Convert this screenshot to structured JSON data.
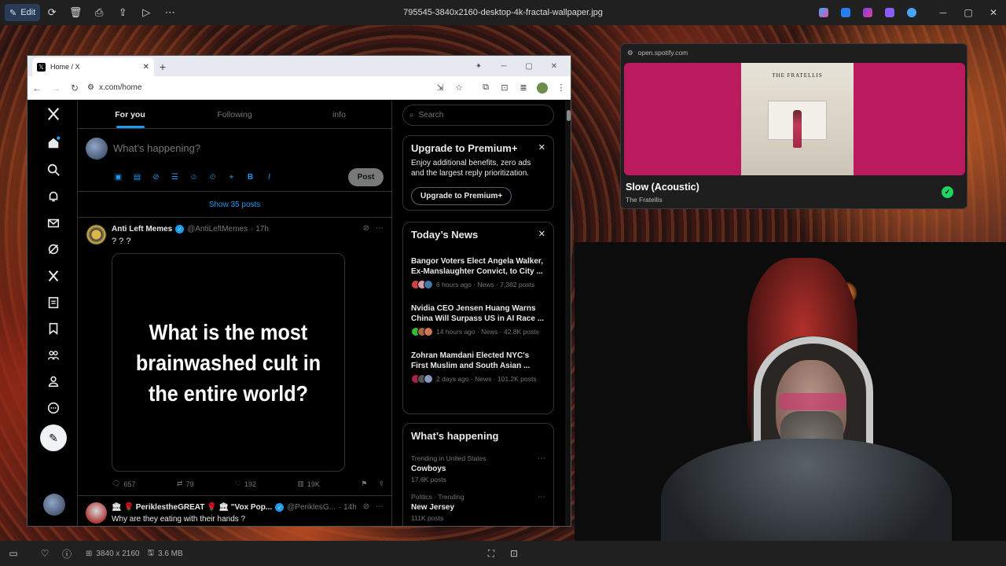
{
  "viewer": {
    "edit_label": "Edit",
    "file_title": "795545-3840x2160-desktop-4k-fractal-wallpaper.jpg",
    "dimensions": "3840 x 2160",
    "file_size": "3.6 MB"
  },
  "browser": {
    "tab_title": "Home / X",
    "url": "x.com/home"
  },
  "x": {
    "tabs": [
      "For you",
      "Following",
      "info"
    ],
    "compose_placeholder": "What’s happening?",
    "post_button": "Post",
    "show_posts": "Show 35 posts",
    "tweet1": {
      "name": "Anti Left Memes",
      "handle": "@AntiLeftMemes",
      "time": "· 17h",
      "text": "? ? ?",
      "image_text": "What is the most brainwashed cult in the entire world?",
      "replies": "657",
      "reposts": "79",
      "likes": "192",
      "views": "19K"
    },
    "tweet2": {
      "name": "🏛 🌹 PeriklestheGREAT 🌹 🏛 \"Vox Pop...",
      "handle": "@PeriklesG...",
      "time": "· 14h",
      "text": "Why are they eating with their hands ?"
    },
    "search_placeholder": "Search",
    "premium": {
      "title": "Upgrade to Premium+",
      "body": "Enjoy additional benefits, zero ads and the largest reply prioritization.",
      "button": "Upgrade to Premium+"
    },
    "news": {
      "title": "Today’s News",
      "items": [
        {
          "headline": "Bangor Voters Elect Angela Walker, Ex-Manslaughter Convict, to City ...",
          "meta": "6 hours ago · News · 7,382 posts"
        },
        {
          "headline": "Nvidia CEO Jensen Huang Warns China Will Surpass US in AI Race ...",
          "meta": "14 hours ago · News · 42.8K posts"
        },
        {
          "headline": "Zohran Mamdani Elected NYC's First Muslim and South Asian ...",
          "meta": "2 days ago · News · 101.2K posts"
        }
      ]
    },
    "happening": {
      "title": "What’s happening",
      "items": [
        {
          "category": "Trending in United States",
          "name": "Cowboys",
          "count": "17.6K posts"
        },
        {
          "category": "Politics · Trending",
          "name": "New Jersey",
          "count": "111K posts"
        }
      ]
    }
  },
  "spotify": {
    "url": "open.spotify.com",
    "album_band": "THE FRATELLIS",
    "track": "Slow (Acoustic)",
    "artist": "The Fratellis"
  },
  "colors": {
    "x_blue": "#1d9bf0",
    "spotify_green": "#1ed760",
    "album_pink": "#bb1a5f"
  }
}
